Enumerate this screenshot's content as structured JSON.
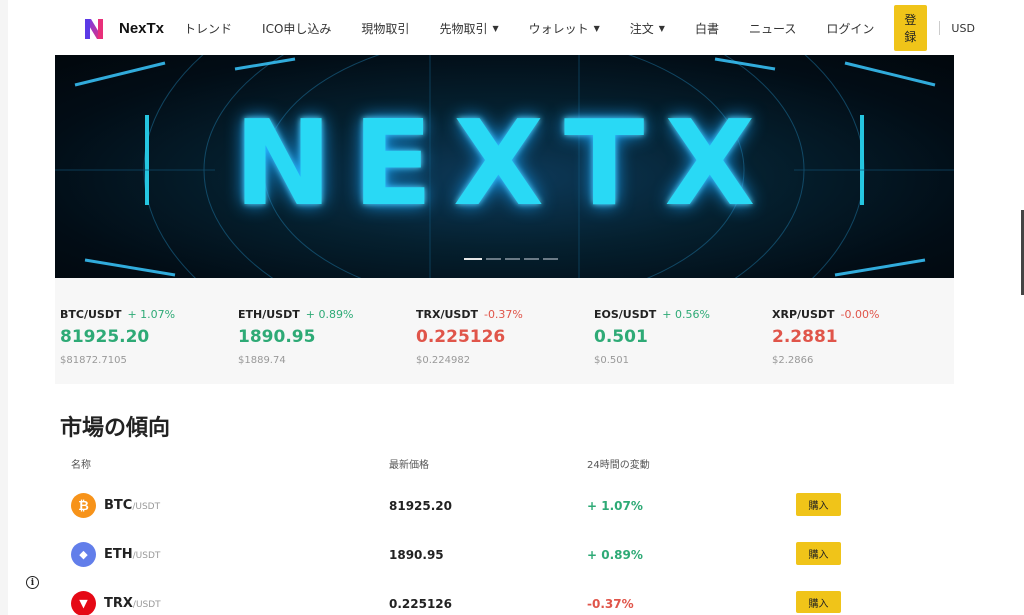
{
  "nav": {
    "brand": "NexTx",
    "items": [
      {
        "label": "トレンド",
        "caret": false
      },
      {
        "label": "ICO申し込み",
        "caret": false
      },
      {
        "label": "現物取引",
        "caret": false
      },
      {
        "label": "先物取引",
        "caret": true
      },
      {
        "label": "ウォレット",
        "caret": true
      },
      {
        "label": "注文",
        "caret": true
      },
      {
        "label": "白書",
        "caret": false
      },
      {
        "label": "ニュース",
        "caret": false
      },
      {
        "label": "ログイン",
        "caret": false
      }
    ],
    "register_label": "登録",
    "currency": "USD"
  },
  "banner": {
    "text": "NEXTX",
    "slide_count": 5,
    "active_slide": 1
  },
  "ticker": [
    {
      "pair": "BTC/USDT",
      "change": "+ 1.07%",
      "price": "81925.20",
      "usd": "$81872.7105",
      "dir": "up"
    },
    {
      "pair": "ETH/USDT",
      "change": "+ 0.89%",
      "price": "1890.95",
      "usd": "$1889.74",
      "dir": "up"
    },
    {
      "pair": "TRX/USDT",
      "change": "-0.37%",
      "price": "0.225126",
      "usd": "$0.224982",
      "dir": "down"
    },
    {
      "pair": "EOS/USDT",
      "change": "+ 0.56%",
      "price": "0.501",
      "usd": "$0.501",
      "dir": "up"
    },
    {
      "pair": "XRP/USDT",
      "change": "-0.00%",
      "price": "2.2881",
      "usd": "$2.2866",
      "dir": "down"
    }
  ],
  "market": {
    "title": "市場の傾向",
    "headers": {
      "name": "名称",
      "price": "最新価格",
      "change": "24時間の変動"
    },
    "rows": [
      {
        "symbol": "BTC",
        "quote": "/USDT",
        "price": "81925.20",
        "change": "+ 1.07%",
        "dir": "up",
        "icon_color": "#f7931a",
        "icon_glyph": "₿"
      },
      {
        "symbol": "ETH",
        "quote": "/USDT",
        "price": "1890.95",
        "change": "+ 0.89%",
        "dir": "up",
        "icon_color": "#627eea",
        "icon_glyph": "◆"
      },
      {
        "symbol": "TRX",
        "quote": "/USDT",
        "price": "0.225126",
        "change": "-0.37%",
        "dir": "down",
        "icon_color": "#e50915",
        "icon_glyph": "▼"
      }
    ],
    "buy_label": "購入"
  },
  "colors": {
    "accent": "#f0c419",
    "up": "#2eaa76",
    "down": "#e0554a"
  }
}
